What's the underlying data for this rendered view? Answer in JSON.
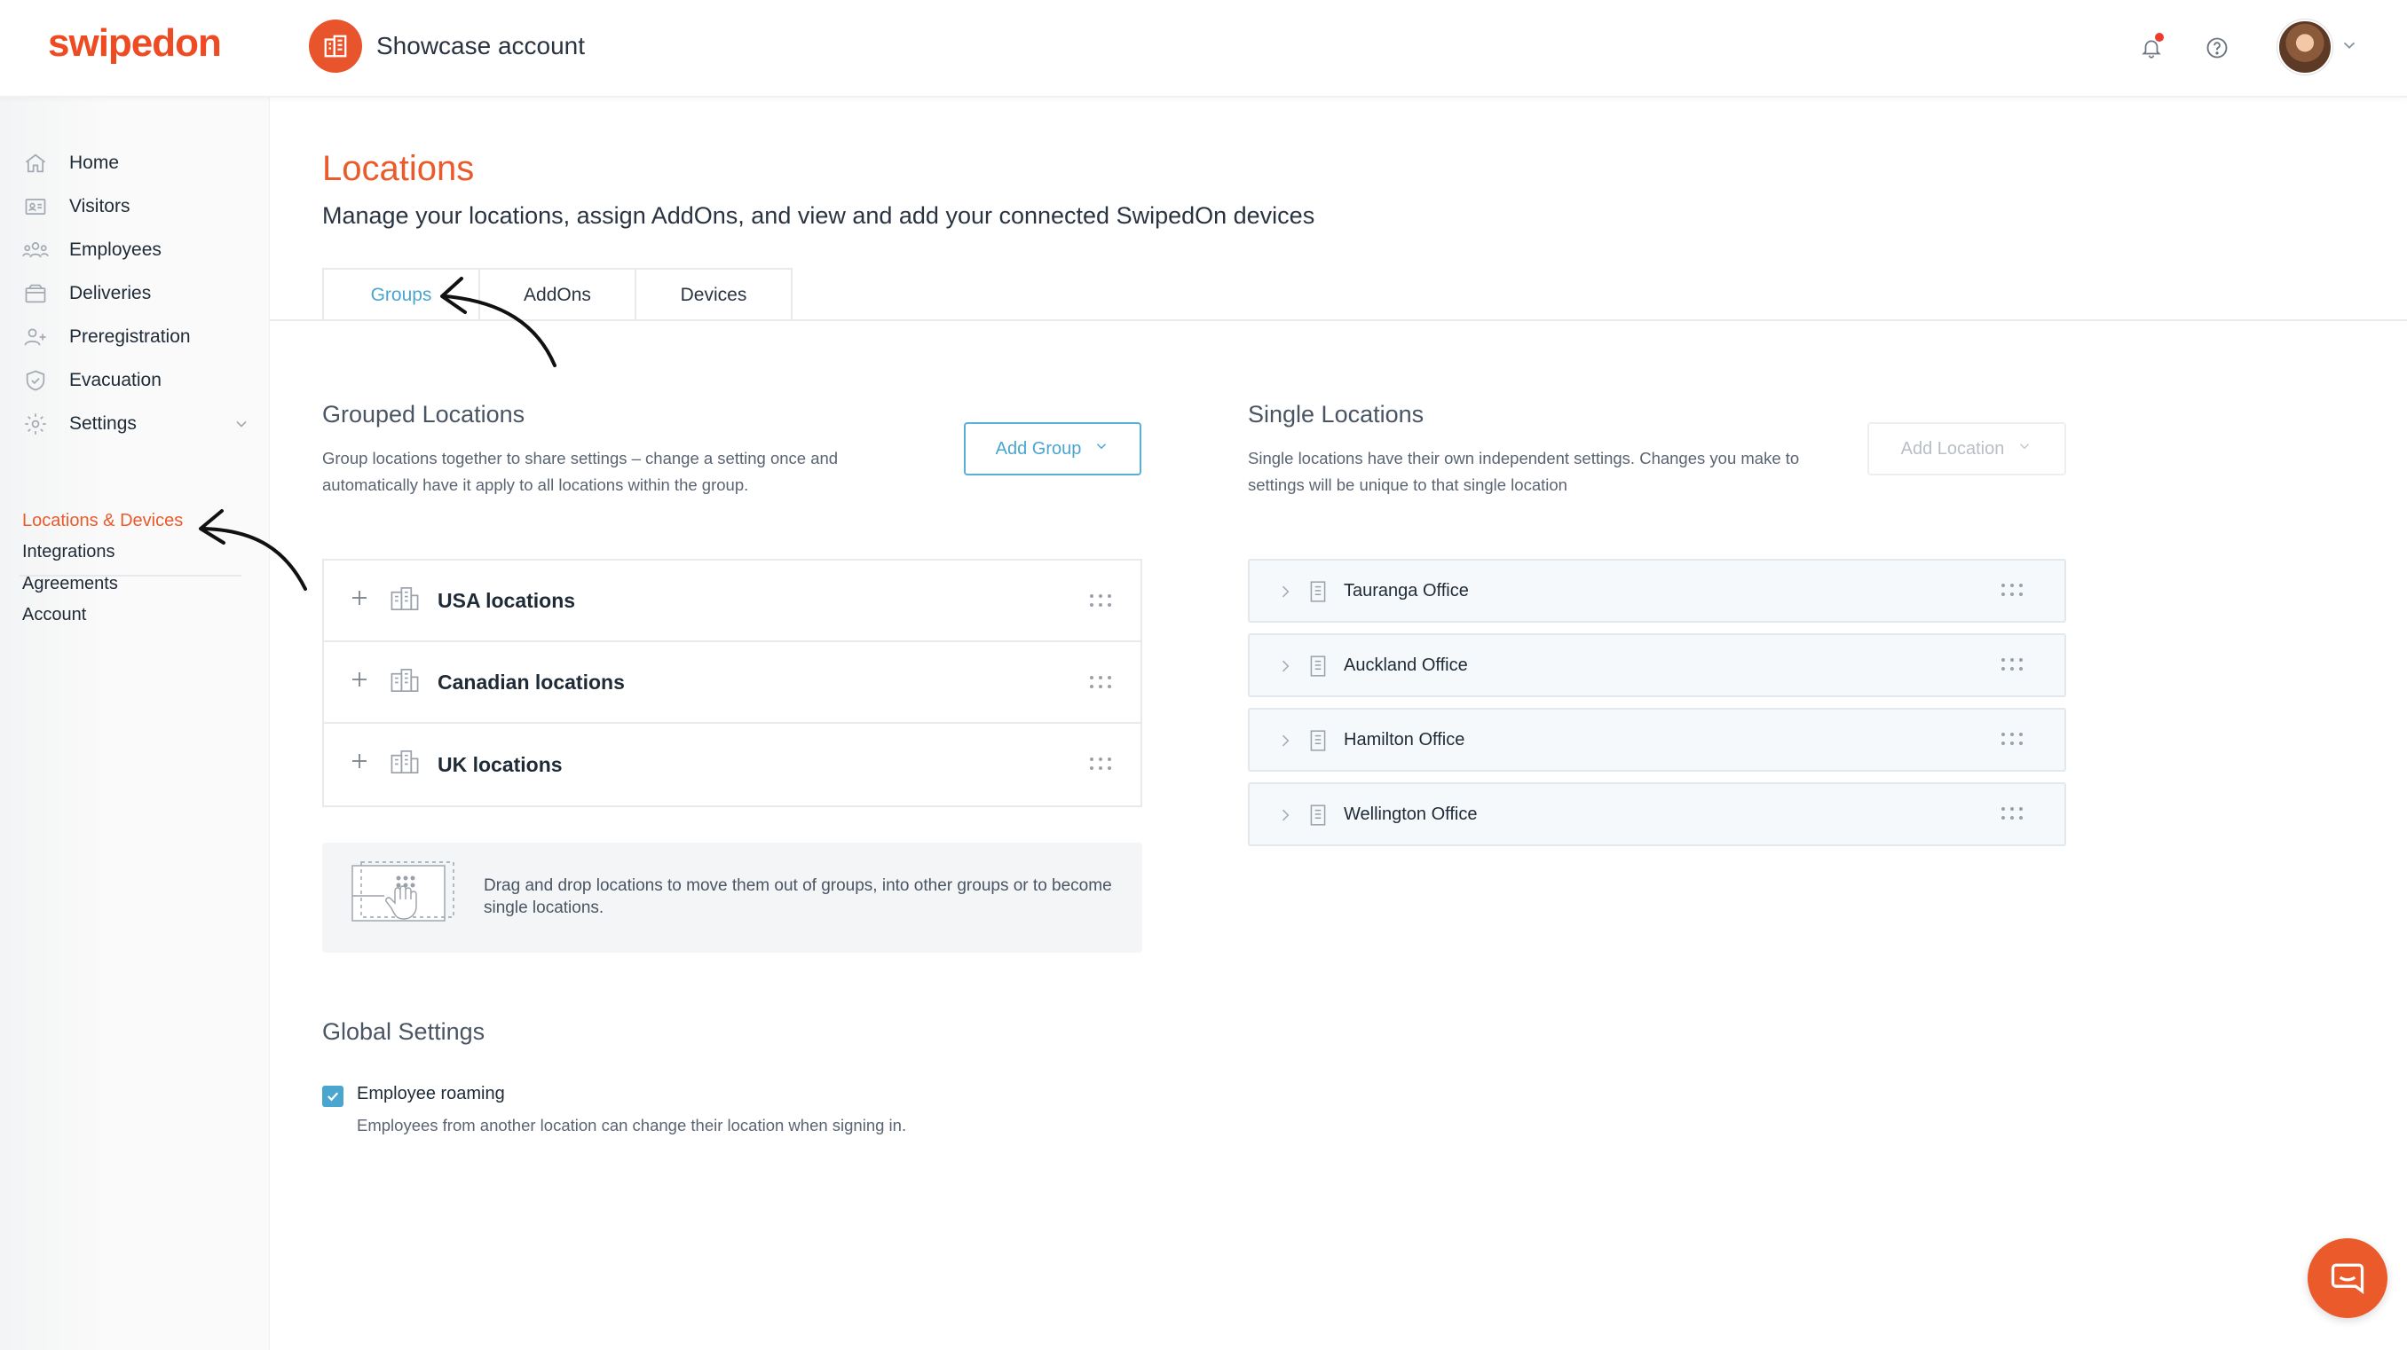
{
  "brand": {
    "logo_text": "swipedon",
    "accent": "#ea5a2b",
    "link_blue": "#4aa5cf"
  },
  "header": {
    "account_name": "Showcase account",
    "account_icon": "building-icon",
    "notifications_icon": "bell-icon",
    "help_icon": "help-circle-icon",
    "has_unread_notifications": true
  },
  "sidebar": {
    "nav": [
      {
        "label": "Home",
        "icon": "home-icon"
      },
      {
        "label": "Visitors",
        "icon": "visitor-card-icon"
      },
      {
        "label": "Employees",
        "icon": "people-icon"
      },
      {
        "label": "Deliveries",
        "icon": "package-icon"
      },
      {
        "label": "Preregistration",
        "icon": "user-plus-icon"
      },
      {
        "label": "Evacuation",
        "icon": "shield-icon"
      },
      {
        "label": "Settings",
        "icon": "gear-icon"
      }
    ],
    "links": [
      {
        "label": "Locations & Devices",
        "active": true
      },
      {
        "label": "Integrations",
        "active": false
      },
      {
        "label": "Agreements",
        "active": false
      },
      {
        "label": "Account",
        "active": false
      }
    ]
  },
  "page": {
    "title": "Locations",
    "subtitle": "Manage your locations, assign AddOns, and view and add your connected SwipedOn devices"
  },
  "tabs": [
    {
      "label": "Groups",
      "active": true
    },
    {
      "label": "AddOns",
      "active": false
    },
    {
      "label": "Devices",
      "active": false
    }
  ],
  "grouped": {
    "title": "Grouped Locations",
    "description": "Group locations together to share settings – change a setting once and automatically have it apply to all locations within the group.",
    "add_button": "Add Group",
    "groups": [
      {
        "name": "USA locations"
      },
      {
        "name": "Canadian locations"
      },
      {
        "name": "UK locations"
      }
    ],
    "dnd_hint": "Drag and drop locations to move them out of groups, into other groups or to become single locations."
  },
  "single": {
    "title": "Single Locations",
    "description": "Single locations have their own independent settings. Changes you make to settings will be unique to that single location",
    "add_button": "Add Location",
    "locations": [
      {
        "name": "Tauranga Office"
      },
      {
        "name": "Auckland Office"
      },
      {
        "name": "Hamilton Office"
      },
      {
        "name": "Wellington Office"
      }
    ]
  },
  "global": {
    "title": "Global Settings",
    "employee_roaming": {
      "label": "Employee roaming",
      "checked": true,
      "description": "Employees from another location can change their location when signing in."
    }
  }
}
